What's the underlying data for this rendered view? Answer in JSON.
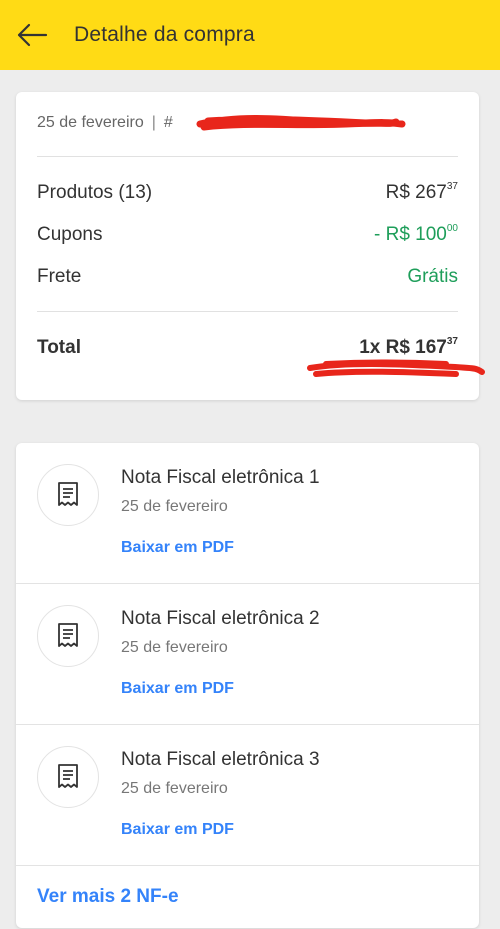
{
  "header": {
    "title": "Detalhe da compra",
    "background": "#ffdb15"
  },
  "summary": {
    "date": "25 de fevereiro",
    "order_prefix": "#",
    "rows": {
      "produtos": {
        "label": "Produtos (13)",
        "currency": "R$ 267",
        "cents": "37"
      },
      "cupons": {
        "label": "Cupons",
        "currency": "- R$ 100",
        "cents": "00"
      },
      "frete": {
        "label": "Frete",
        "value": "Grátis"
      },
      "total": {
        "label": "Total",
        "currency": "1x R$ 167",
        "cents": "37"
      }
    }
  },
  "invoices": {
    "items": [
      {
        "title": "Nota Fiscal eletrônica 1",
        "date": "25 de fevereiro",
        "link": "Baixar em PDF"
      },
      {
        "title": "Nota Fiscal eletrônica 2",
        "date": "25 de fevereiro",
        "link": "Baixar em PDF"
      },
      {
        "title": "Nota Fiscal eletrônica 3",
        "date": "25 de fevereiro",
        "link": "Baixar em PDF"
      }
    ],
    "see_more": "Ver mais 2 NF-e"
  },
  "colors": {
    "accent_blue": "#3483fa",
    "positive_green": "#1e9e5a",
    "redaction_red": "#e8261b"
  }
}
